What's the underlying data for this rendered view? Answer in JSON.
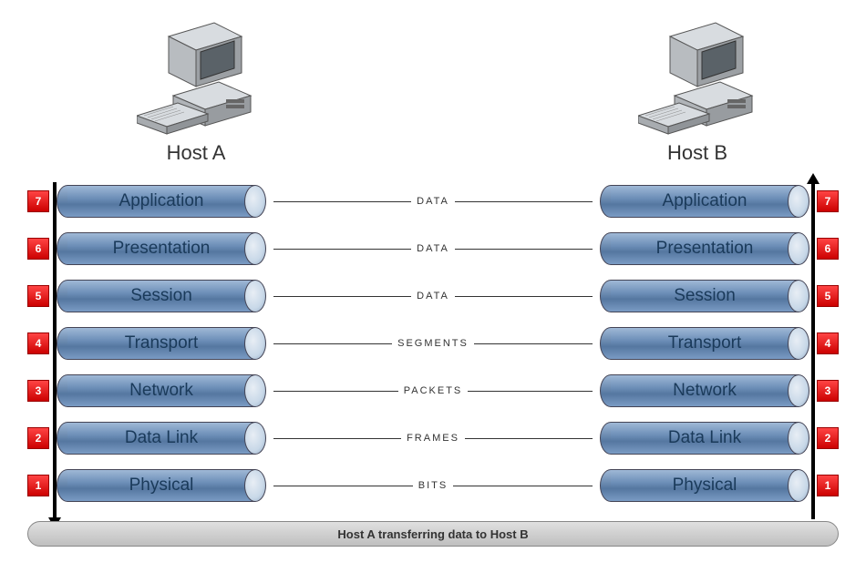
{
  "hostA_label": "Host A",
  "hostB_label": "Host B",
  "layers": [
    {
      "num": "7",
      "name": "Application",
      "pdu": "DATA"
    },
    {
      "num": "6",
      "name": "Presentation",
      "pdu": "DATA"
    },
    {
      "num": "5",
      "name": "Session",
      "pdu": "DATA"
    },
    {
      "num": "4",
      "name": "Transport",
      "pdu": "SEGMENTS"
    },
    {
      "num": "3",
      "name": "Network",
      "pdu": "PACKETS"
    },
    {
      "num": "2",
      "name": "Data Link",
      "pdu": "FRAMES"
    },
    {
      "num": "1",
      "name": "Physical",
      "pdu": "BITS"
    }
  ],
  "footer": "Host A transferring data to Host B"
}
